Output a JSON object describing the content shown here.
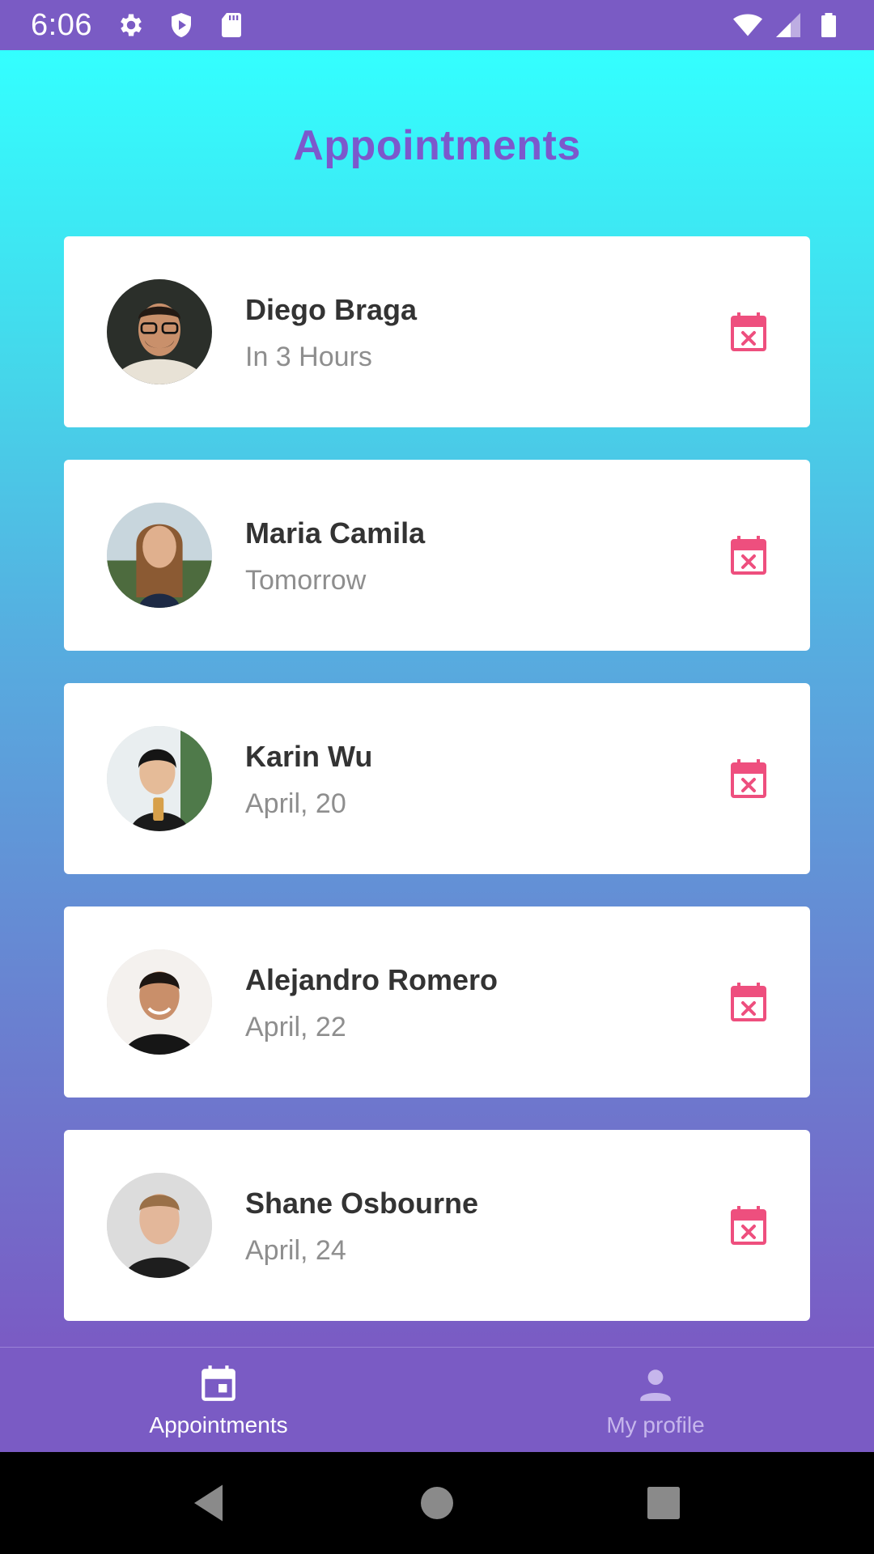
{
  "status_bar": {
    "time": "6:06",
    "left_icons": [
      "settings-icon",
      "shield-icon",
      "sd-card-icon"
    ],
    "right_icons": [
      "wifi-icon",
      "signal-icon",
      "battery-icon"
    ]
  },
  "header": {
    "title": "Appointments"
  },
  "colors": {
    "accent": "#7c58cc",
    "cancel": "#ee4f7e",
    "nav_bg": "#7a5bc4",
    "gradient_top": "#33ffff",
    "gradient_bottom": "#7a5bc4"
  },
  "appointments": [
    {
      "name": "Diego Braga",
      "when": "In 3 Hours",
      "action_icon": "calendar-cancel-icon"
    },
    {
      "name": "Maria Camila",
      "when": "Tomorrow",
      "action_icon": "calendar-cancel-icon"
    },
    {
      "name": "Karin Wu",
      "when": "April, 20",
      "action_icon": "calendar-cancel-icon"
    },
    {
      "name": "Alejandro Romero",
      "when": "April, 22",
      "action_icon": "calendar-cancel-icon"
    },
    {
      "name": "Shane Osbourne",
      "when": "April, 24",
      "action_icon": "calendar-cancel-icon"
    }
  ],
  "bottom_nav": {
    "items": [
      {
        "label": "Appointments",
        "icon": "calendar-icon",
        "active": true
      },
      {
        "label": "My profile",
        "icon": "person-icon",
        "active": false
      }
    ]
  },
  "system_nav": [
    "back-icon",
    "home-icon",
    "recents-icon"
  ]
}
